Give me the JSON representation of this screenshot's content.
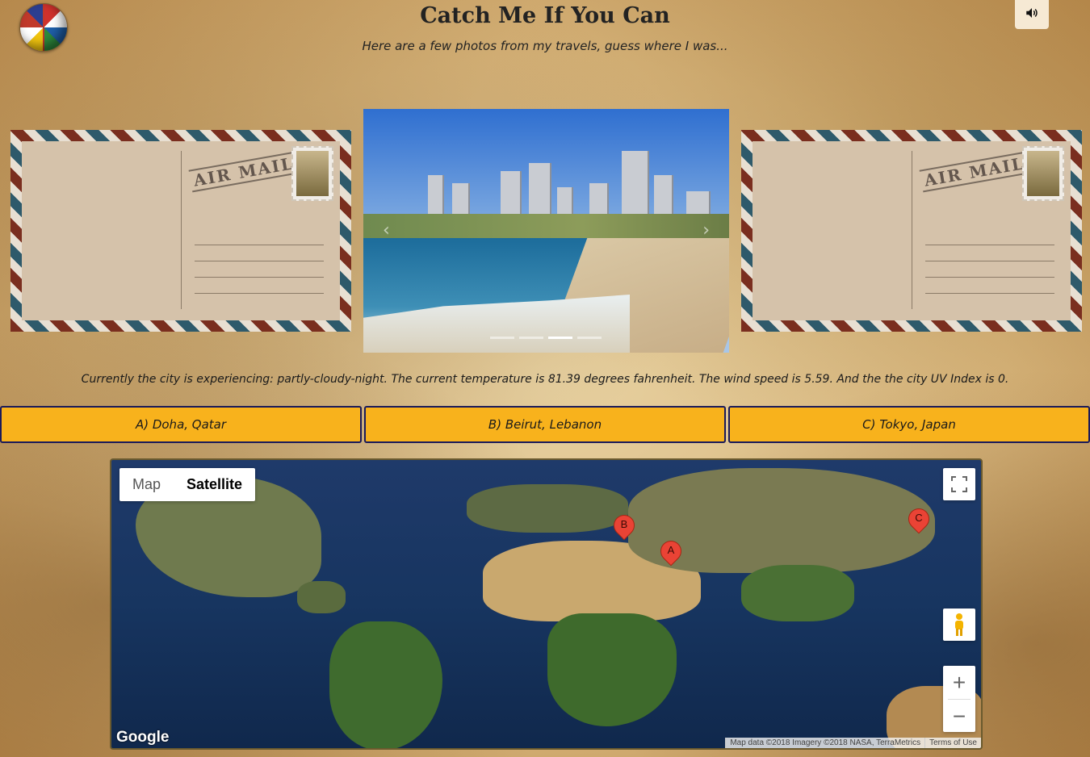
{
  "header": {
    "title": "Catch Me If You Can",
    "subtitle": "Here are a few photos from my travels, guess where I was..."
  },
  "postcard": {
    "stamp_text": "AIR MAIL"
  },
  "carousel": {
    "slide_count": 4,
    "active_index": 2
  },
  "weather": {
    "text": "Currently the city is experiencing: partly-cloudy-night. The current temperature is 81.39 degrees fahrenheit. The wind speed is 5.59. And the the city UV Index is 0."
  },
  "answers": [
    {
      "label": "A) Doha, Qatar"
    },
    {
      "label": "B) Beirut, Lebanon"
    },
    {
      "label": "C) Tokyo, Japan"
    }
  ],
  "map": {
    "type_map": "Map",
    "type_satellite": "Satellite",
    "selected_type": "Satellite",
    "markers": [
      {
        "label": "A"
      },
      {
        "label": "B"
      },
      {
        "label": "C"
      }
    ],
    "google_logo": "Google",
    "attribution": "Map data ©2018 Imagery ©2018 NASA, TerraMetrics",
    "terms": "Terms of Use",
    "zoom_in": "+",
    "zoom_out": "−"
  },
  "icons": {
    "sound": "volume-icon",
    "fullscreen": "fullscreen-icon",
    "pegman": "pegman-icon",
    "prev": "chevron-left-icon",
    "next": "chevron-right-icon"
  },
  "colors": {
    "answer_bg": "#f8b21c",
    "answer_border": "#1a1a5a",
    "marker": "#ea4335"
  }
}
